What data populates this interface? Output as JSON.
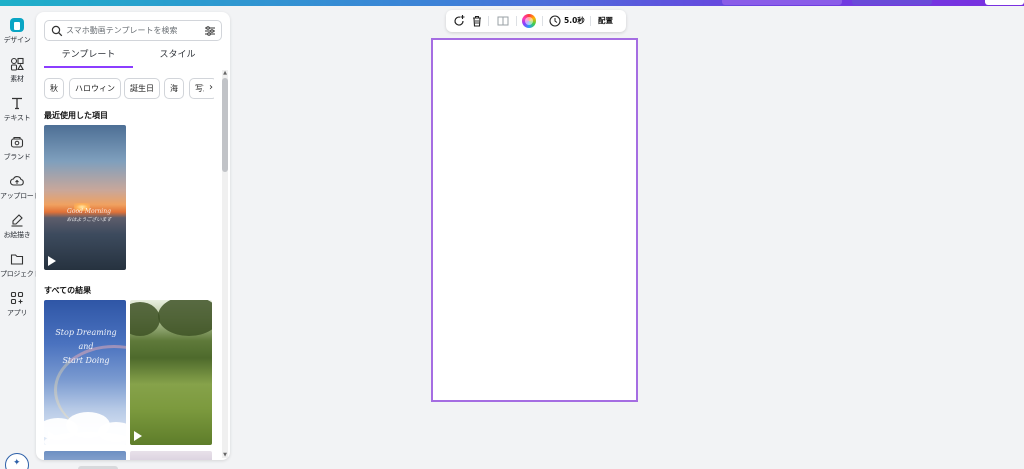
{
  "colors": {
    "accent": "#8b3dff",
    "canvas_border": "#a56de2",
    "rail_active": "#0aa5c4"
  },
  "rail": {
    "items": [
      {
        "label": "デザイン",
        "icon": "design-icon"
      },
      {
        "label": "素材",
        "icon": "elements-icon"
      },
      {
        "label": "テキスト",
        "icon": "text-icon"
      },
      {
        "label": "ブランド",
        "icon": "brand-icon"
      },
      {
        "label": "アップロード",
        "icon": "upload-icon"
      },
      {
        "label": "お絵描き",
        "icon": "draw-icon"
      },
      {
        "label": "プロジェクト",
        "icon": "folder-icon"
      },
      {
        "label": "アプリ",
        "icon": "apps-icon"
      }
    ]
  },
  "panel": {
    "search": {
      "placeholder": "スマホ動画テンプレートを検索",
      "value": ""
    },
    "tabs": [
      {
        "label": "テンプレート",
        "active": true
      },
      {
        "label": "スタイル",
        "active": false
      }
    ],
    "chips": [
      "秋",
      "ハロウィン",
      "誕生日",
      "海",
      "写真"
    ],
    "recent_title": "最近使用した項目",
    "recent": [
      {
        "overlay": "Good Morning",
        "overlay2": "おはようございます"
      }
    ],
    "all_title": "すべての結果",
    "results": [
      {
        "overlay": "Stop Dreaming and",
        "overlay2": "Start Doing"
      }
    ]
  },
  "toolbar": {
    "duration": "5.0秒",
    "position": "配置"
  }
}
